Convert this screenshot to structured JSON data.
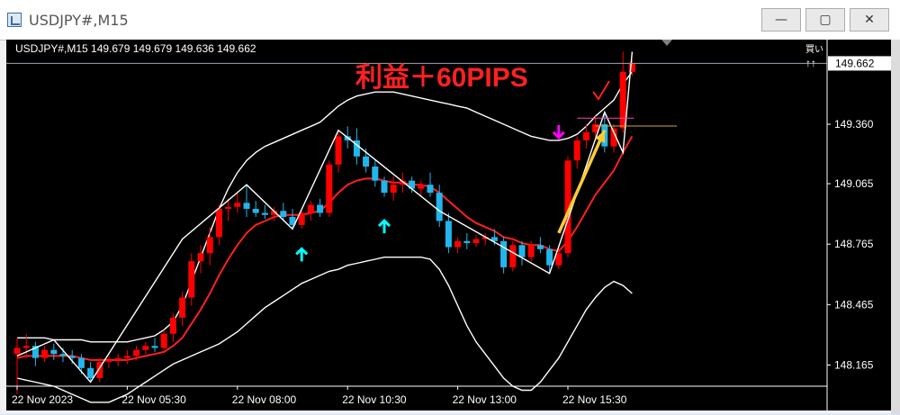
{
  "window": {
    "title": "USDJPY#,M15",
    "buttons": {
      "minimize": "—",
      "maximize": "▢",
      "close": "✕"
    }
  },
  "chart_header": "USDJPY#,M15  149.679 149.679 149.636 149.662",
  "annotation": "利益＋60PIPS",
  "buy_label": "買い",
  "buy_arrows": "↑↑",
  "current_price_label": "149.662",
  "colors": {
    "background": "#000000",
    "bull_candle": "#ff0000",
    "bear_candle": "#22b6ec",
    "ma_line": "#ff2020",
    "bands": "#ffffff",
    "zigzag": "#ffffff",
    "up_signal": "#00ffff",
    "down_signal": "#ff00ff",
    "trend_arrow": "#ffcc33",
    "annotation_text": "#ff2020"
  },
  "chart_data": {
    "type": "candlestick",
    "symbol": "USDJPY#",
    "timeframe": "M15",
    "y_ticks": [
      "149.360",
      "149.065",
      "148.765",
      "148.465",
      "148.165"
    ],
    "x_ticks": [
      "22 Nov 2023",
      "22 Nov 05:30",
      "22 Nov 08:00",
      "22 Nov 10:30",
      "22 Nov 13:00",
      "22 Nov 15:30"
    ],
    "ylim": [
      148.06,
      149.78
    ],
    "current_price": 149.662,
    "take_profit_level": 149.36,
    "candles": [
      {
        "o": 148.22,
        "h": 148.3,
        "l": 148.02,
        "c": 148.25
      },
      {
        "o": 148.25,
        "h": 148.32,
        "l": 148.2,
        "c": 148.26
      },
      {
        "o": 148.26,
        "h": 148.28,
        "l": 148.16,
        "c": 148.2
      },
      {
        "o": 148.2,
        "h": 148.26,
        "l": 148.18,
        "c": 148.24
      },
      {
        "o": 148.24,
        "h": 148.27,
        "l": 148.19,
        "c": 148.22
      },
      {
        "o": 148.22,
        "h": 148.25,
        "l": 148.18,
        "c": 148.21
      },
      {
        "o": 148.21,
        "h": 148.24,
        "l": 148.17,
        "c": 148.2
      },
      {
        "o": 148.2,
        "h": 148.22,
        "l": 148.12,
        "c": 148.15
      },
      {
        "o": 148.15,
        "h": 148.18,
        "l": 148.08,
        "c": 148.1
      },
      {
        "o": 148.1,
        "h": 148.2,
        "l": 148.08,
        "c": 148.18
      },
      {
        "o": 148.18,
        "h": 148.21,
        "l": 148.15,
        "c": 148.19
      },
      {
        "o": 148.19,
        "h": 148.22,
        "l": 148.16,
        "c": 148.2
      },
      {
        "o": 148.2,
        "h": 148.24,
        "l": 148.17,
        "c": 148.21
      },
      {
        "o": 148.21,
        "h": 148.26,
        "l": 148.19,
        "c": 148.24
      },
      {
        "o": 148.24,
        "h": 148.28,
        "l": 148.22,
        "c": 148.26
      },
      {
        "o": 148.26,
        "h": 148.3,
        "l": 148.23,
        "c": 148.25
      },
      {
        "o": 148.25,
        "h": 148.34,
        "l": 148.24,
        "c": 148.32
      },
      {
        "o": 148.32,
        "h": 148.42,
        "l": 148.28,
        "c": 148.4
      },
      {
        "o": 148.4,
        "h": 148.53,
        "l": 148.36,
        "c": 148.5
      },
      {
        "o": 148.5,
        "h": 148.72,
        "l": 148.46,
        "c": 148.68
      },
      {
        "o": 148.68,
        "h": 148.76,
        "l": 148.62,
        "c": 148.72
      },
      {
        "o": 148.72,
        "h": 148.85,
        "l": 148.66,
        "c": 148.8
      },
      {
        "o": 148.8,
        "h": 148.96,
        "l": 148.76,
        "c": 148.94
      },
      {
        "o": 148.94,
        "h": 148.99,
        "l": 148.88,
        "c": 148.95
      },
      {
        "o": 148.95,
        "h": 149.02,
        "l": 148.92,
        "c": 148.97
      },
      {
        "o": 148.97,
        "h": 149.06,
        "l": 148.9,
        "c": 148.94
      },
      {
        "o": 148.94,
        "h": 148.98,
        "l": 148.9,
        "c": 148.92
      },
      {
        "o": 148.92,
        "h": 148.96,
        "l": 148.89,
        "c": 148.91
      },
      {
        "o": 148.91,
        "h": 148.95,
        "l": 148.88,
        "c": 148.93
      },
      {
        "o": 148.93,
        "h": 148.97,
        "l": 148.88,
        "c": 148.9
      },
      {
        "o": 148.9,
        "h": 148.94,
        "l": 148.84,
        "c": 148.86
      },
      {
        "o": 148.86,
        "h": 148.93,
        "l": 148.84,
        "c": 148.92
      },
      {
        "o": 148.92,
        "h": 148.98,
        "l": 148.88,
        "c": 148.96
      },
      {
        "o": 148.96,
        "h": 148.99,
        "l": 148.9,
        "c": 148.92
      },
      {
        "o": 148.92,
        "h": 149.18,
        "l": 148.9,
        "c": 149.16
      },
      {
        "o": 149.16,
        "h": 149.33,
        "l": 149.12,
        "c": 149.3
      },
      {
        "o": 149.3,
        "h": 149.35,
        "l": 149.24,
        "c": 149.28
      },
      {
        "o": 149.28,
        "h": 149.34,
        "l": 149.16,
        "c": 149.2
      },
      {
        "o": 149.2,
        "h": 149.24,
        "l": 149.12,
        "c": 149.15
      },
      {
        "o": 149.15,
        "h": 149.18,
        "l": 149.05,
        "c": 149.08
      },
      {
        "o": 149.08,
        "h": 149.1,
        "l": 149.0,
        "c": 149.02
      },
      {
        "o": 149.02,
        "h": 149.1,
        "l": 148.98,
        "c": 149.06
      },
      {
        "o": 149.06,
        "h": 149.12,
        "l": 149.02,
        "c": 149.08
      },
      {
        "o": 149.08,
        "h": 149.1,
        "l": 149.02,
        "c": 149.04
      },
      {
        "o": 149.04,
        "h": 149.08,
        "l": 149.0,
        "c": 149.06
      },
      {
        "o": 149.06,
        "h": 149.12,
        "l": 149.0,
        "c": 149.02
      },
      {
        "o": 149.02,
        "h": 149.06,
        "l": 148.85,
        "c": 148.88
      },
      {
        "o": 148.88,
        "h": 148.92,
        "l": 148.72,
        "c": 148.75
      },
      {
        "o": 148.75,
        "h": 148.8,
        "l": 148.72,
        "c": 148.78
      },
      {
        "o": 148.78,
        "h": 148.82,
        "l": 148.74,
        "c": 148.77
      },
      {
        "o": 148.77,
        "h": 148.81,
        "l": 148.75,
        "c": 148.79
      },
      {
        "o": 148.79,
        "h": 148.82,
        "l": 148.76,
        "c": 148.8
      },
      {
        "o": 148.8,
        "h": 148.84,
        "l": 148.76,
        "c": 148.78
      },
      {
        "o": 148.78,
        "h": 148.8,
        "l": 148.62,
        "c": 148.65
      },
      {
        "o": 148.65,
        "h": 148.78,
        "l": 148.63,
        "c": 148.76
      },
      {
        "o": 148.76,
        "h": 148.78,
        "l": 148.66,
        "c": 148.7
      },
      {
        "o": 148.7,
        "h": 148.78,
        "l": 148.68,
        "c": 148.76
      },
      {
        "o": 148.76,
        "h": 148.8,
        "l": 148.72,
        "c": 148.74
      },
      {
        "o": 148.74,
        "h": 148.76,
        "l": 148.62,
        "c": 148.66
      },
      {
        "o": 148.66,
        "h": 148.76,
        "l": 148.64,
        "c": 148.72
      },
      {
        "o": 148.72,
        "h": 149.2,
        "l": 148.7,
        "c": 149.18
      },
      {
        "o": 149.18,
        "h": 149.3,
        "l": 149.14,
        "c": 149.28
      },
      {
        "o": 149.28,
        "h": 149.36,
        "l": 149.24,
        "c": 149.32
      },
      {
        "o": 149.32,
        "h": 149.4,
        "l": 149.28,
        "c": 149.36
      },
      {
        "o": 149.36,
        "h": 149.42,
        "l": 149.22,
        "c": 149.25
      },
      {
        "o": 149.25,
        "h": 149.36,
        "l": 149.22,
        "c": 149.34
      },
      {
        "o": 149.34,
        "h": 149.72,
        "l": 149.32,
        "c": 149.62
      },
      {
        "o": 149.62,
        "h": 149.68,
        "l": 149.6,
        "c": 149.66
      }
    ],
    "ma": [
      148.2,
      148.21,
      148.21,
      148.21,
      148.21,
      148.21,
      148.21,
      148.2,
      148.19,
      148.19,
      148.19,
      148.19,
      148.19,
      148.2,
      148.21,
      148.22,
      148.23,
      148.26,
      148.3,
      148.37,
      148.44,
      148.52,
      148.61,
      148.69,
      148.76,
      148.82,
      148.86,
      148.88,
      148.9,
      148.91,
      148.91,
      148.91,
      148.92,
      148.93,
      148.97,
      149.02,
      149.06,
      149.08,
      149.09,
      149.09,
      149.08,
      149.07,
      149.07,
      149.06,
      149.06,
      149.05,
      149.02,
      148.98,
      148.94,
      148.9,
      148.87,
      148.85,
      148.83,
      148.8,
      148.79,
      148.77,
      148.76,
      148.76,
      148.74,
      148.73,
      148.78,
      148.85,
      148.93,
      149.01,
      149.07,
      149.13,
      149.22,
      149.3
    ],
    "upper_band": [
      148.3,
      148.3,
      148.3,
      148.3,
      148.29,
      148.29,
      148.29,
      148.29,
      148.28,
      148.28,
      148.28,
      148.28,
      148.28,
      148.29,
      148.3,
      148.31,
      148.34,
      148.38,
      148.46,
      148.58,
      148.7,
      148.82,
      148.94,
      149.04,
      149.12,
      149.18,
      149.22,
      149.25,
      149.27,
      149.29,
      149.31,
      149.33,
      149.35,
      149.37,
      149.41,
      149.45,
      149.48,
      149.5,
      149.51,
      149.52,
      149.52,
      149.52,
      149.51,
      149.5,
      149.49,
      149.48,
      149.47,
      149.46,
      149.45,
      149.44,
      149.42,
      149.4,
      149.38,
      149.36,
      149.34,
      149.32,
      149.3,
      149.29,
      149.28,
      149.28,
      149.29,
      149.31,
      149.35,
      149.4,
      149.44,
      149.48,
      149.56,
      149.62
    ],
    "lower_band": [
      148.1,
      148.09,
      148.08,
      148.07,
      148.06,
      148.04,
      148.02,
      148.0,
      147.98,
      147.98,
      147.98,
      148.0,
      148.02,
      148.05,
      148.08,
      148.11,
      148.14,
      148.17,
      148.19,
      148.21,
      148.23,
      148.25,
      148.27,
      148.3,
      148.33,
      148.37,
      148.41,
      148.45,
      148.48,
      148.51,
      148.54,
      148.57,
      148.59,
      148.61,
      148.63,
      148.64,
      148.66,
      148.67,
      148.68,
      148.69,
      148.7,
      148.7,
      148.7,
      148.7,
      148.7,
      148.69,
      148.64,
      148.56,
      148.46,
      148.36,
      148.28,
      148.22,
      148.16,
      148.1,
      148.06,
      148.04,
      148.04,
      148.08,
      148.14,
      148.2,
      148.28,
      148.36,
      148.44,
      148.5,
      148.55,
      148.58,
      148.56,
      148.52
    ],
    "zigzag": [
      [
        0,
        148.21
      ],
      [
        4,
        148.29
      ],
      [
        8,
        148.08
      ],
      [
        18,
        148.79
      ],
      [
        25,
        149.06
      ],
      [
        30,
        148.84
      ],
      [
        35,
        149.33
      ],
      [
        46,
        148.93
      ],
      [
        58,
        148.62
      ],
      [
        64,
        149.42
      ],
      [
        66,
        149.22
      ],
      [
        67,
        149.72
      ]
    ],
    "up_arrows": [
      {
        "i": 31,
        "v": 148.84
      },
      {
        "i": 40,
        "v": 148.98
      }
    ],
    "down_arrows": [
      {
        "i": 59,
        "v": 149.24
      }
    ]
  }
}
